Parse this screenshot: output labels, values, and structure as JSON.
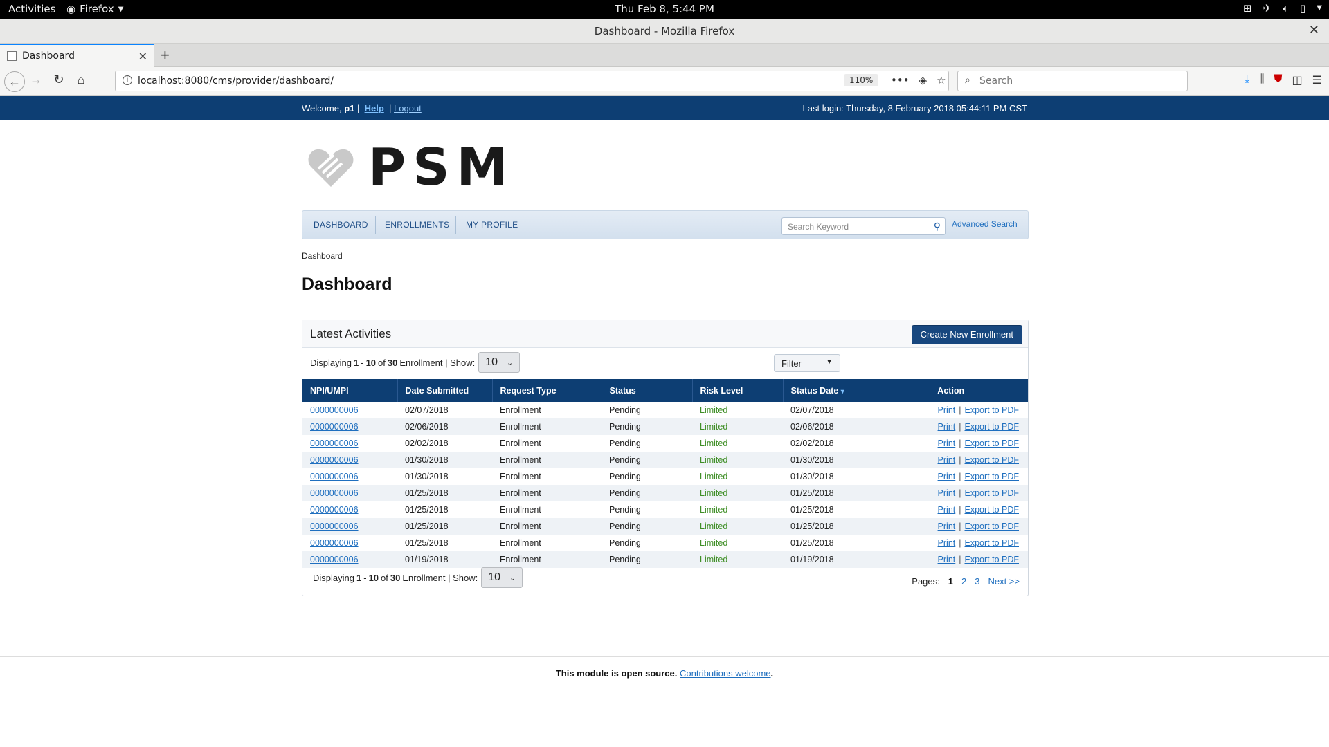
{
  "system": {
    "activities": "Activities",
    "app": "Firefox",
    "clock": "Thu Feb  8,  5:44 PM"
  },
  "window": {
    "title": "Dashboard - Mozilla Firefox"
  },
  "browser": {
    "tab_title": "Dashboard",
    "url": "localhost:8080/cms/provider/dashboard/",
    "zoom": "110%",
    "search_placeholder": "Search"
  },
  "topbar": {
    "welcome": "Welcome,",
    "user": "p1",
    "separator": "|",
    "help": "Help",
    "logout": "Logout",
    "last_login": "Last login: Thursday, 8 February 2018 05:44:11 PM CST"
  },
  "logo": {
    "text": "PSM"
  },
  "nav": {
    "items": [
      "DASHBOARD",
      "ENROLLMENTS",
      "MY PROFILE"
    ],
    "search_placeholder": "Search Keyword",
    "advanced_search": "Advanced Search"
  },
  "breadcrumb": "Dashboard",
  "page_title": "Dashboard",
  "panel": {
    "title": "Latest Activities",
    "create_button": "Create New Enrollment",
    "displaying": "Displaying",
    "range_start": "1",
    "dash": "-",
    "range_end": "10",
    "of": "of",
    "total": "30",
    "entity": "Enrollment | Show:",
    "show_value": "10",
    "filter": "Filter",
    "columns": [
      "NPI/UMPI",
      "Date Submitted",
      "Request Type",
      "Status",
      "Risk Level",
      "Status Date",
      "Action"
    ],
    "sort_indicator": "▾",
    "rows": [
      {
        "npi": "0000000006",
        "submitted": "02/07/2018",
        "type": "Enrollment",
        "status": "Pending",
        "risk": "Limited",
        "status_date": "02/07/2018"
      },
      {
        "npi": "0000000006",
        "submitted": "02/06/2018",
        "type": "Enrollment",
        "status": "Pending",
        "risk": "Limited",
        "status_date": "02/06/2018"
      },
      {
        "npi": "0000000006",
        "submitted": "02/02/2018",
        "type": "Enrollment",
        "status": "Pending",
        "risk": "Limited",
        "status_date": "02/02/2018"
      },
      {
        "npi": "0000000006",
        "submitted": "01/30/2018",
        "type": "Enrollment",
        "status": "Pending",
        "risk": "Limited",
        "status_date": "01/30/2018"
      },
      {
        "npi": "0000000006",
        "submitted": "01/30/2018",
        "type": "Enrollment",
        "status": "Pending",
        "risk": "Limited",
        "status_date": "01/30/2018"
      },
      {
        "npi": "0000000006",
        "submitted": "01/25/2018",
        "type": "Enrollment",
        "status": "Pending",
        "risk": "Limited",
        "status_date": "01/25/2018"
      },
      {
        "npi": "0000000006",
        "submitted": "01/25/2018",
        "type": "Enrollment",
        "status": "Pending",
        "risk": "Limited",
        "status_date": "01/25/2018"
      },
      {
        "npi": "0000000006",
        "submitted": "01/25/2018",
        "type": "Enrollment",
        "status": "Pending",
        "risk": "Limited",
        "status_date": "01/25/2018"
      },
      {
        "npi": "0000000006",
        "submitted": "01/25/2018",
        "type": "Enrollment",
        "status": "Pending",
        "risk": "Limited",
        "status_date": "01/25/2018"
      },
      {
        "npi": "0000000006",
        "submitted": "01/19/2018",
        "type": "Enrollment",
        "status": "Pending",
        "risk": "Limited",
        "status_date": "01/19/2018"
      }
    ],
    "action_print": "Print",
    "action_sep": "|",
    "action_export": "Export to PDF",
    "pages_label": "Pages:",
    "pages": [
      "1",
      "2",
      "3"
    ],
    "next": "Next >>"
  },
  "footer": {
    "text": "This module is open source.",
    "link": "Contributions welcome",
    "period": "."
  },
  "colors": {
    "header_blue": "#0d3e73",
    "link_blue": "#1f6fbf",
    "risk_green": "#3e8e25"
  }
}
